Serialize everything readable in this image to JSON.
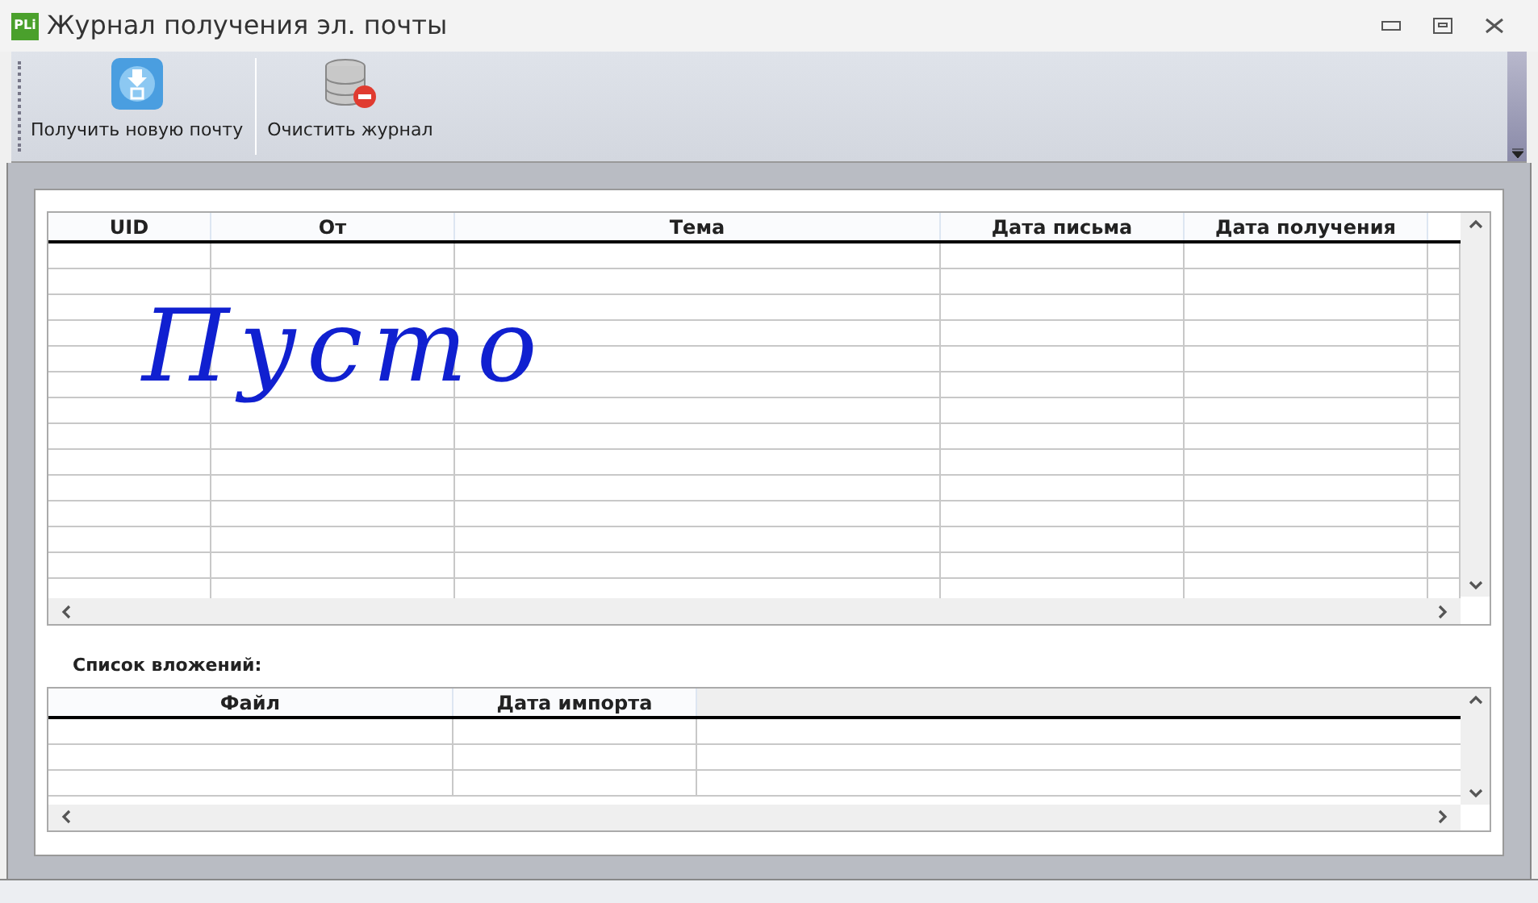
{
  "window": {
    "title": "Журнал получения эл. почты",
    "logo": "PLi"
  },
  "toolbar": {
    "buttons": [
      {
        "label": "Получить новую почту",
        "kind": "download"
      },
      {
        "label": "Очистить журнал",
        "kind": "clear"
      }
    ]
  },
  "mail_table": {
    "columns": [
      "UID",
      "От",
      "Тема",
      "Дата письма",
      "Дата получения"
    ],
    "note": "Пусто"
  },
  "attachments": {
    "label": "Список вложений:",
    "columns": [
      "Файл",
      "Дата импорта"
    ]
  }
}
